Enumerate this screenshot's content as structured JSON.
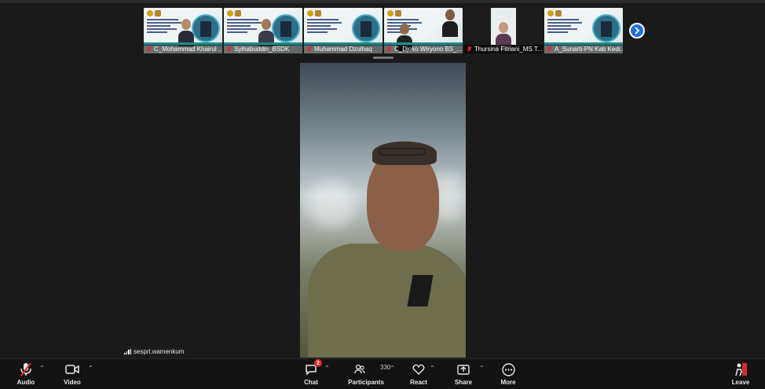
{
  "thumbnails": [
    {
      "name": "C_Mohammad Khairul ..."
    },
    {
      "name": "Syihabuddin_BSDK"
    },
    {
      "name": "Muhammad Dzulhaq"
    },
    {
      "name": "C_Djoko Wiryono BS_..."
    },
    {
      "name": "Thursina Fitriani_MS T..."
    },
    {
      "name": "A_Sunarti-PN Kab Kedi..."
    }
  ],
  "self_view": {
    "name": "sesprl.wamenkum"
  },
  "toolbar": {
    "audio": "Audio",
    "video": "Video",
    "chat": "Chat",
    "chat_badge": "2",
    "participants": "Participants",
    "participants_count": "330",
    "react": "React",
    "share": "Share",
    "more": "More",
    "leave": "Leave"
  },
  "colors": {
    "accent": "#1f6fe0",
    "danger": "#e02828",
    "toolbar_bg": "#121212"
  }
}
